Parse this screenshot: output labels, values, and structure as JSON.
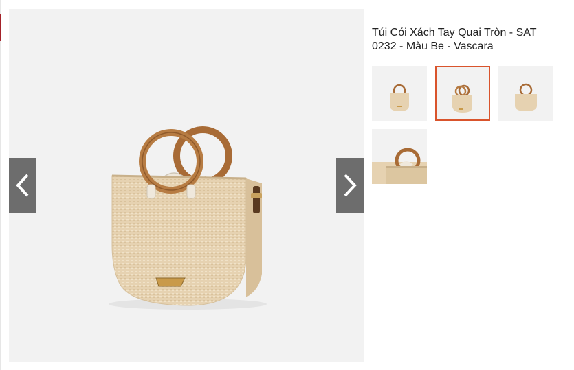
{
  "product": {
    "title": "Túi Cói Xách Tay Quai Tròn - SAT 0232 - Màu Be - Vascara"
  },
  "viewer": {
    "prev_icon": "chevron-left-icon",
    "next_icon": "chevron-right-icon",
    "image_subject": "bag"
  },
  "thumbnails": [
    {
      "view": "front",
      "selected": false
    },
    {
      "view": "three-quarter",
      "selected": true
    },
    {
      "view": "back",
      "selected": false
    },
    {
      "view": "handle-detail",
      "selected": false
    }
  ],
  "colors": {
    "accent": "#d9542c",
    "nav_button": "#6d6d6d",
    "image_background": "#f2f2f2",
    "bag_body": "#e7d3b3",
    "wood_handle": "#b27a44"
  }
}
